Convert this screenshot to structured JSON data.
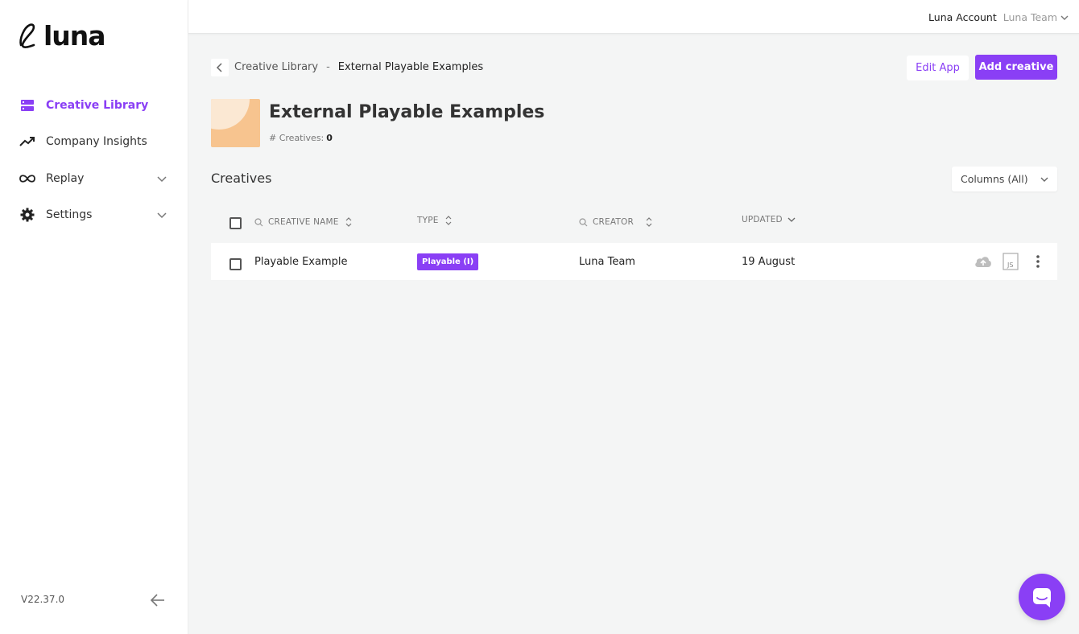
{
  "brand": {
    "name": "luna"
  },
  "sidebar": {
    "items": [
      {
        "label": "Creative Library",
        "icon": "library-icon",
        "active": true
      },
      {
        "label": "Company Insights",
        "icon": "trend-icon",
        "active": false
      },
      {
        "label": "Replay",
        "icon": "infinity-icon",
        "active": false,
        "expandable": true
      },
      {
        "label": "Settings",
        "icon": "gear-icon",
        "active": false,
        "expandable": true
      }
    ],
    "version": "V22.37.0"
  },
  "topbar": {
    "account": "Luna Account",
    "team": "Luna Team"
  },
  "breadcrumb": {
    "parent": "Creative Library",
    "separator": "-",
    "current": "External Playable Examples"
  },
  "actions": {
    "edit": "Edit App",
    "add": "Add creative"
  },
  "app": {
    "title": "External Playable Examples",
    "creatives_label": "# Creatives:",
    "creatives_count": "0"
  },
  "creatives": {
    "title": "Creatives",
    "columns_dropdown": "Columns (All)",
    "headers": {
      "name": "CREATIVE NAME",
      "type": "TYPE",
      "creator": "CREATOR",
      "updated": "UPDATED"
    },
    "rows": [
      {
        "name": "Playable Example",
        "type": "Playable (I)",
        "creator": "Luna Team",
        "updated": "19 August"
      }
    ]
  },
  "colors": {
    "accent": "#8a3ff5",
    "background": "#f4f5f5",
    "thumb": "#f7c48f"
  }
}
